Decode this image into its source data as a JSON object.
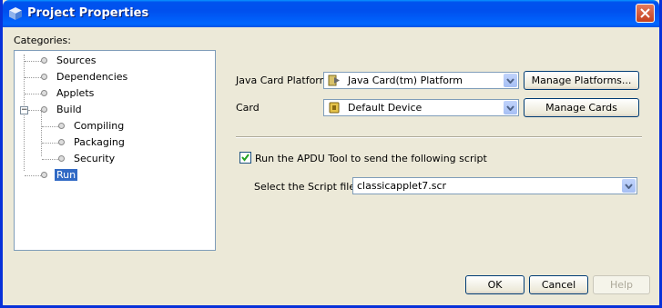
{
  "window": {
    "title": "Project Properties"
  },
  "categories": {
    "label": "Categories:",
    "items": [
      {
        "label": "Sources"
      },
      {
        "label": "Dependencies"
      },
      {
        "label": "Applets"
      },
      {
        "label": "Build"
      },
      {
        "label": "Compiling"
      },
      {
        "label": "Packaging"
      },
      {
        "label": "Security"
      },
      {
        "label": "Run",
        "selected": true
      }
    ]
  },
  "platform": {
    "label": "Java Card Platform",
    "value": "Java Card(tm) Platform",
    "manage_button": "Manage Platforms..."
  },
  "card": {
    "label": "Card",
    "value": "Default Device",
    "manage_button": "Manage Cards"
  },
  "apdu": {
    "checkbox_label": "Run the APDU Tool to send the following script",
    "checked": true,
    "script_label": "Select the Script file:",
    "script_value": "classicapplet7.scr"
  },
  "footer": {
    "ok": "OK",
    "cancel": "Cancel",
    "help": "Help"
  },
  "colors": {
    "title_bar": "#0054e3",
    "selection": "#316ac5",
    "dialog_bg": "#ece9d8"
  }
}
